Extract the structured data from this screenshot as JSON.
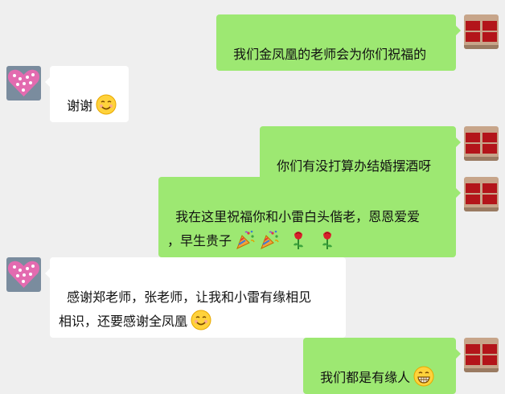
{
  "messages": [
    {
      "side": "right",
      "text": "我们金凤凰的老师会为你们祝福的",
      "emoji": []
    },
    {
      "side": "left",
      "text": "谢谢",
      "emoji": [
        "smiling-face-icon"
      ]
    },
    {
      "side": "right",
      "text": "你们有没打算办结婚摆酒呀",
      "emoji": []
    },
    {
      "side": "right",
      "text": "我在这里祝福你和小雷白头偕老，恩恩爱爱\n，早生贵子",
      "emoji": [
        "party-popper-icon",
        "party-popper-icon",
        "rose-icon",
        "rose-icon"
      ]
    },
    {
      "side": "left",
      "text": "感谢郑老师，张老师，让我和小雷有缘相见\n相识，还要感谢全凤凰",
      "emoji": [
        "smiling-face-icon"
      ]
    },
    {
      "side": "right",
      "text": "我们都是有缘人",
      "emoji": [
        "grinning-face-icon"
      ]
    }
  ],
  "colors": {
    "background": "#efefef",
    "my_bubble": "#9de872",
    "their_bubble": "#ffffff"
  }
}
